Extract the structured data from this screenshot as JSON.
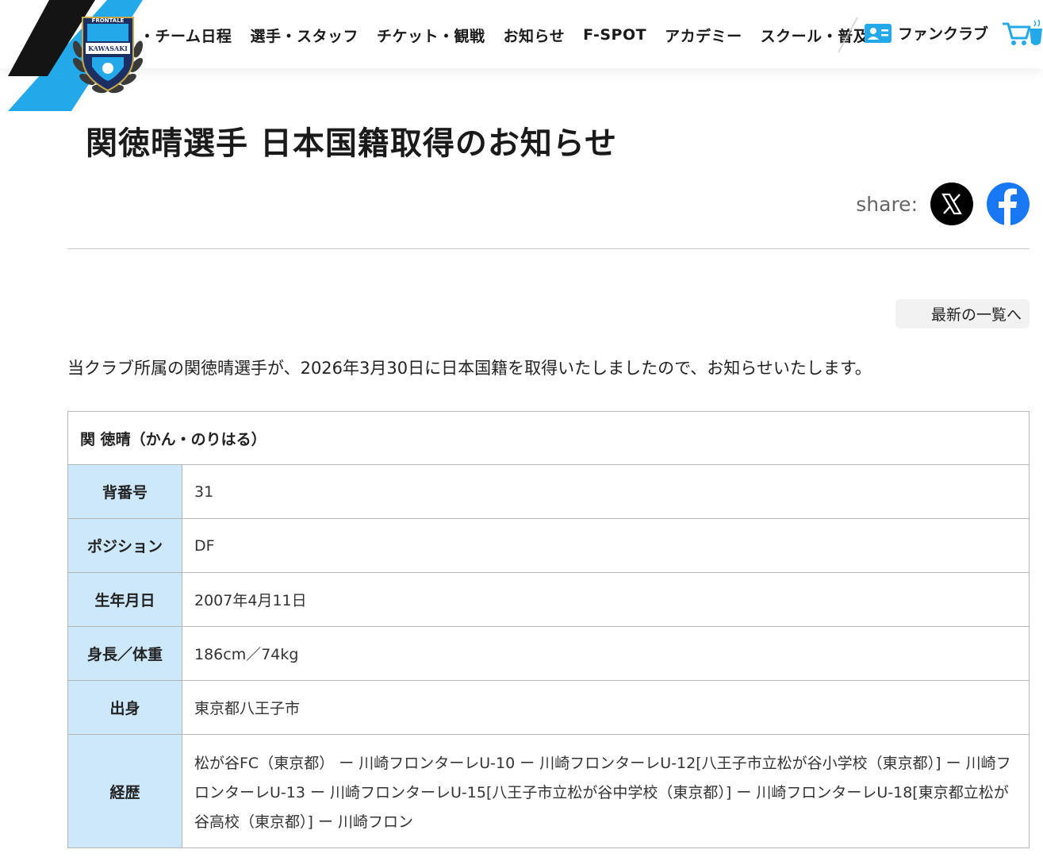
{
  "header": {
    "logo_text_top": "FRONTALE",
    "logo_text_mid": "KAWASAKI",
    "nav": [
      "・チーム日程",
      "選手・スタッフ",
      "チケット・観戦",
      "お知らせ",
      "F-SPOT",
      "アカデミー",
      "スクール・普及"
    ],
    "fanclub_label": "ファンクラブ",
    "colors": {
      "brand_blue": "#23a8ea",
      "brand_black": "#141414"
    }
  },
  "article": {
    "title": "関徳晴選手 日本国籍取得のお知らせ",
    "share_label": "share:",
    "share_icons": [
      "x-icon",
      "facebook-icon"
    ],
    "back_link": "最新の一覧へ",
    "lead": "当クラブ所属の関徳晴選手が、2026年3月30日に日本国籍を取得いたしましたので、お知らせいたします。"
  },
  "profile": {
    "name": "関 徳晴（かん・のりはる）",
    "rows": [
      {
        "key": "背番号",
        "value": "31"
      },
      {
        "key": "ポジション",
        "value": "DF"
      },
      {
        "key": "生年月日",
        "value": "2007年4月11日"
      },
      {
        "key": "身長／体重",
        "value": "186cm／74kg"
      },
      {
        "key": "出身",
        "value": "東京都八王子市"
      },
      {
        "key": "経歴",
        "value": "松が谷FC（東京都） ー 川崎フロンターレU-10 ー 川崎フロンターレU-12[八王子市立松が谷小学校（東京都）] ー 川崎フロンターレU-13 ー 川崎フロンターレU-15[八王子市立松が谷中学校（東京都）] ー 川崎フロンターレU-18[東京都立松が谷高校（東京都）] ー 川崎フロン"
      }
    ]
  }
}
